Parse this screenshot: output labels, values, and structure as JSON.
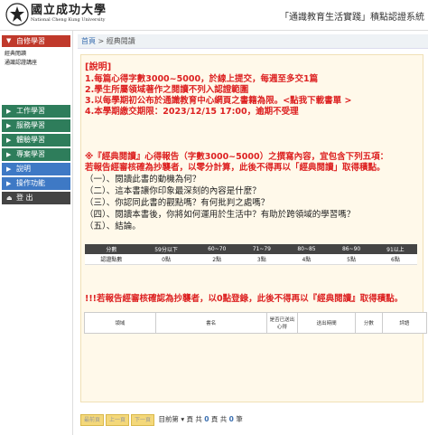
{
  "header": {
    "logo_cn": "國立成功大學",
    "logo_en": "National Cheng Kung University",
    "system_title": "「通識教育生活實踐」積點認證系統"
  },
  "sidebar": {
    "self_study": "自修學習",
    "self_study_items": [
      "經典閱讀",
      "通識認證講座"
    ],
    "work_study": "工作學習",
    "service_study": "服務學習",
    "experience_study": "體驗學習",
    "project_study": "專案學習",
    "instructions": "說明",
    "functions": "操作功能",
    "logout": "登 出"
  },
  "breadcrumb": {
    "home": "首頁",
    "sep": " > ",
    "current": "經典閱讀"
  },
  "notice": {
    "title": "[說明]",
    "rules": [
      "1.每篇心得字數3000~5000，於線上提交，每週至多交1篇",
      "2.學生所屬領域著作之閱讀不列入認證範圍",
      "3.以每學期初公布於通識教育中心網頁之書籍為限。<點我下載書單 >",
      "4.本學期繳交期限：2023/12/15 17:00，逾期不受理"
    ],
    "req_line1": "※『經典閱讀』心得報告（字數3000~5000）之撰寫內容，宜包含下列五項：",
    "req_line2": "若報告經審核確為抄襲者，以零分計算，此後不得再以「經典閱讀」取得積點。",
    "questions": [
      "（一）、閱讀此書的動機為何？",
      "（二）、這本書讓你印象最深刻的內容是什麼？",
      "（三）、你認同此書的觀點嗎？有何批判之處嗎？",
      "（四）、閱讀本書後，你將如何運用於生活中？有助於跨領域的學習嗎？",
      "（五）、結論。"
    ],
    "score_headers": [
      "分數",
      "59分以下",
      "60~70",
      "71~79",
      "80~85",
      "86~90",
      "91以上"
    ],
    "score_values": [
      "認證點數",
      "0點",
      "2點",
      "3點",
      "4點",
      "5點",
      "6點"
    ],
    "warning": "!!!若報告經審核確認為抄襲者，以0點登錄，此後不得再以『經典閱讀』取得積點。"
  },
  "list_table": {
    "headers": [
      "領域",
      "書名",
      "是否已送出心得",
      "送出時間",
      "分數",
      "評語"
    ]
  },
  "pager": {
    "first": "最前頁",
    "prev": "上一頁",
    "next": "下一頁",
    "goto": "目前第",
    "page": "頁",
    "total_prefix": "共",
    "total_pages": "0",
    "pages_suffix": "頁 共",
    "total_records": "0",
    "records_suffix": "筆"
  }
}
